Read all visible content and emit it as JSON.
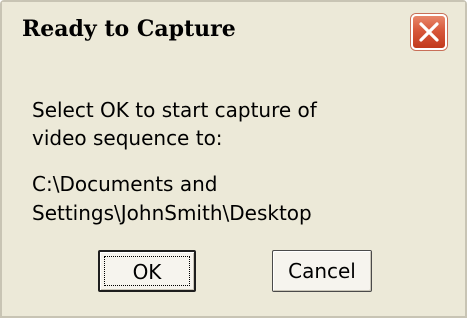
{
  "dialog": {
    "title": "Ready to Capture",
    "message": {
      "line1": "Select OK to start capture of",
      "line2": "video sequence to:",
      "path_line1": "C:\\Documents and",
      "path_line2": "Settings\\JohnSmith\\Desktop"
    },
    "buttons": {
      "ok_label": "OK",
      "cancel_label": "Cancel"
    },
    "icons": {
      "close": "close-icon"
    },
    "colors": {
      "close_button": "#d8583b",
      "dialog_background": "#ece9d8"
    }
  }
}
